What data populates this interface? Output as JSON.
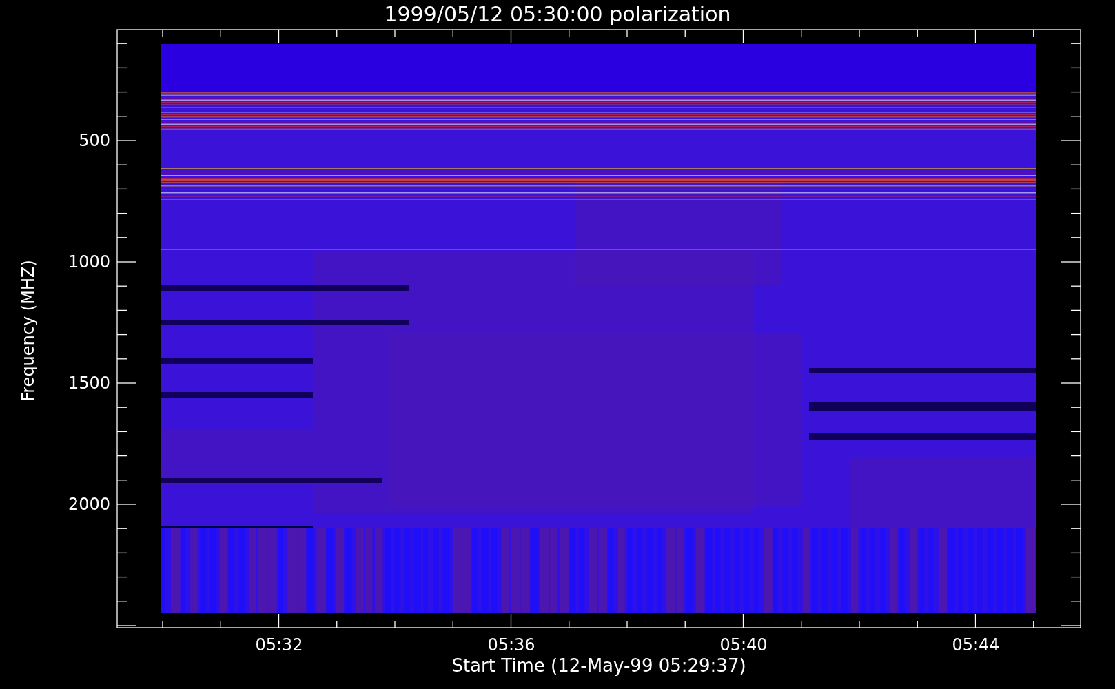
{
  "plot": {
    "title": "1999/05/12 05:30:00 polarization",
    "ylabel": "Frequency (MHZ)",
    "xlabel": "Start Time (12-May-99 05:29:37)",
    "yticks": [
      "500",
      "1000",
      "1500",
      "2000"
    ],
    "xticks": [
      "05:32",
      "05:36",
      "05:40",
      "05:44"
    ]
  }
}
